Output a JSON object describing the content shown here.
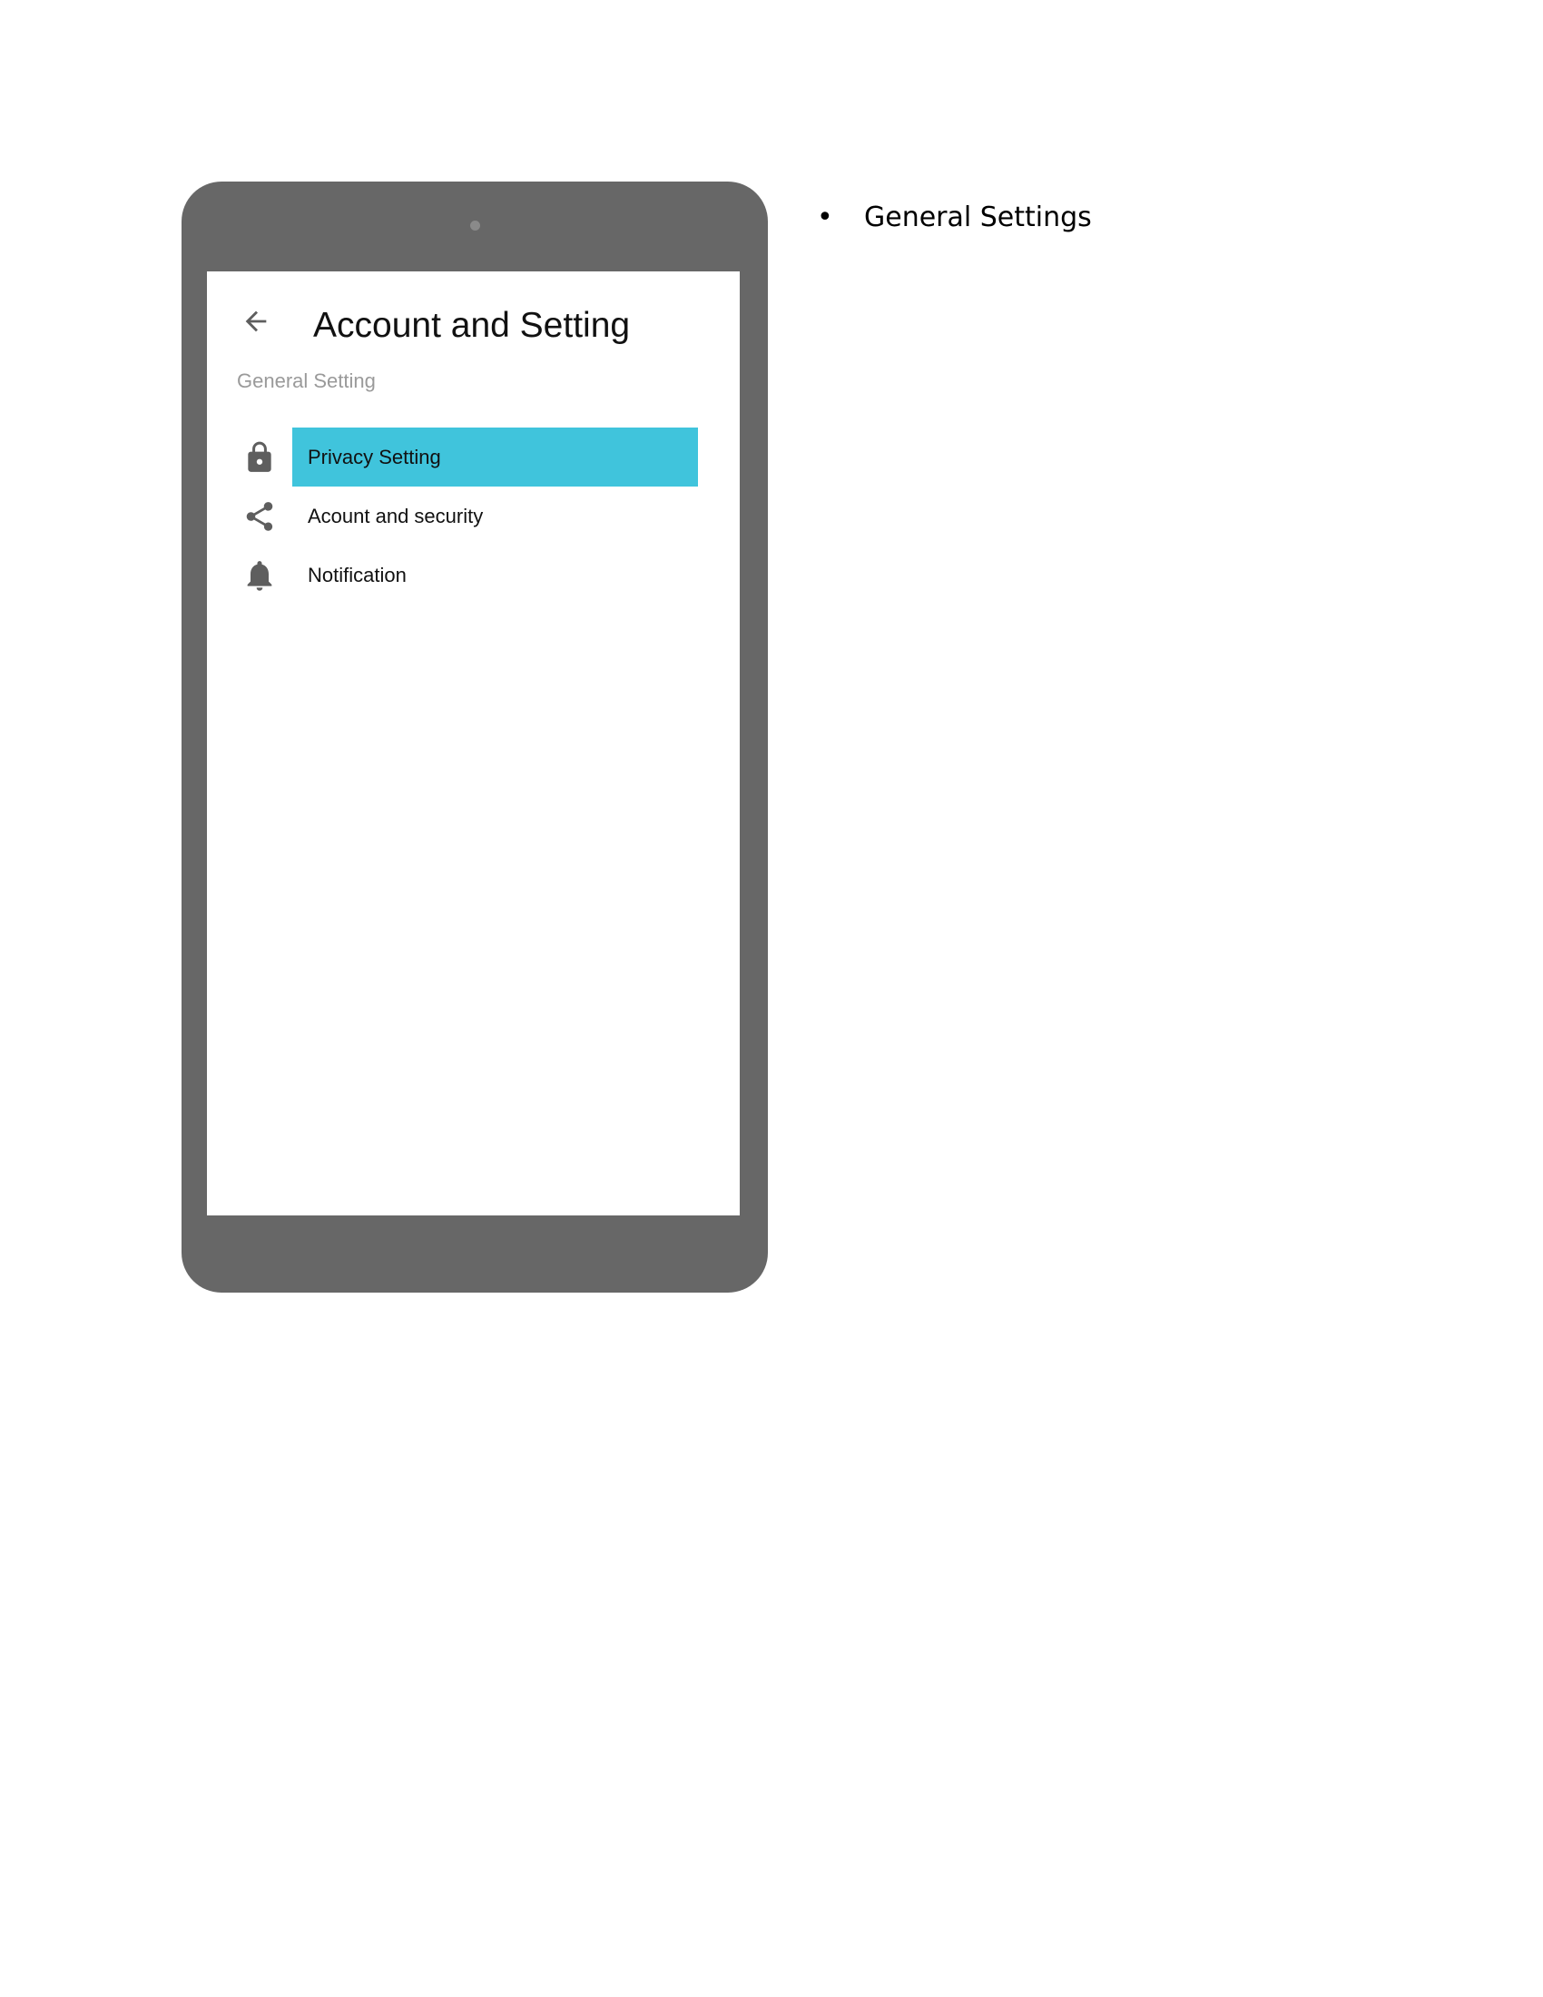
{
  "screen": {
    "title": "Account and Setting",
    "section_label": "General Setting",
    "back_icon": "arrow-back-icon",
    "menu": [
      {
        "label": "Privacy Setting",
        "icon": "lock-icon",
        "selected": true
      },
      {
        "label": "Acount and security",
        "icon": "share-icon",
        "selected": false
      },
      {
        "label": "Notification",
        "icon": "bell-icon",
        "selected": false
      }
    ]
  },
  "annotation": {
    "bullet": "•",
    "text": "General Settings"
  },
  "colors": {
    "device_frame": "#676767",
    "accent": "#40c4dc",
    "icon": "#5e5e5e",
    "muted_text": "#9a9a9a"
  }
}
